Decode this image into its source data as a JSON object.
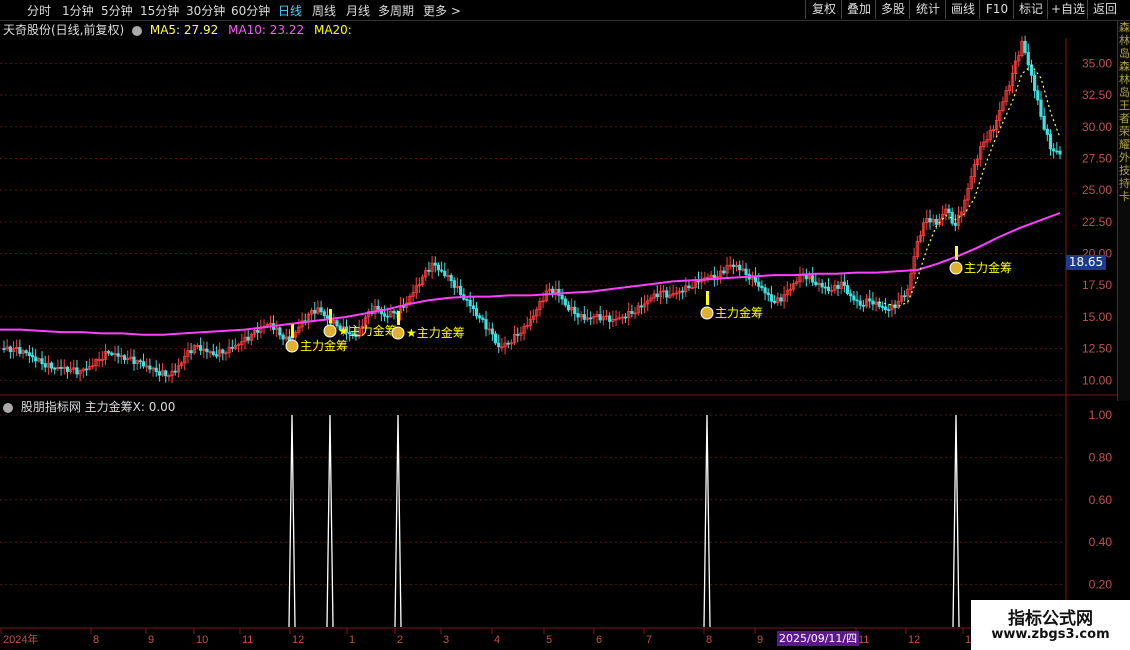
{
  "toolbar": {
    "periods": [
      "分时",
      "1分钟",
      "5分钟",
      "15分钟",
      "30分钟",
      "60分钟",
      "日线",
      "周线",
      "月线",
      "多周期",
      "更多"
    ],
    "more_arrow": ">",
    "buttons": [
      "复权",
      "叠加",
      "多股",
      "统计",
      "画线",
      "F10",
      "标记",
      "+自选",
      "返回"
    ]
  },
  "header": {
    "stock": "天奇股份(日线,前复权)",
    "ma5_label": "MA5: 27.92",
    "ma10_label": "MA10: 23.22",
    "ma20_label": "MA20:",
    "colors": {
      "ma5": "#ffff55",
      "ma10": "#ff55ff",
      "ma20": "#ffff00"
    }
  },
  "indicator_header": "股朋指标网 主力金筹X: 0.00",
  "price_axis": [
    "35.00",
    "32.50",
    "30.00",
    "27.50",
    "25.00",
    "22.50",
    "20.00",
    "17.50",
    "15.00",
    "12.50",
    "10.00"
  ],
  "indicator_axis": [
    "1.00",
    "0.80",
    "0.60",
    "0.40",
    "0.20"
  ],
  "last_price": "18.65",
  "x_axis_labels": [
    "2024年",
    "8",
    "9",
    "10",
    "11",
    "12",
    "1",
    "2",
    "3",
    "4",
    "5",
    "6",
    "7",
    "8",
    "9",
    "11",
    "12",
    "1"
  ],
  "date_badge": "2025/09/11/四",
  "signal_label": "主力金筹",
  "signal_star_label": "★主力金筹",
  "sidebar_chars": [
    "森",
    "林",
    "岛",
    "森",
    "林",
    "岛",
    "王",
    "者",
    "荣",
    "耀",
    "外",
    "技",
    "持",
    "卡"
  ],
  "watermark": {
    "title": "指标公式网",
    "url": "www.zbgs3.com"
  },
  "chart_data": {
    "type": "line",
    "price_range": [
      9,
      37
    ],
    "indicator_range": [
      0,
      1.0
    ],
    "close_prices": [
      12.5,
      12.3,
      12.1,
      11.8,
      11.5,
      11.2,
      11.0,
      10.7,
      10.5,
      11.0,
      11.8,
      12.4,
      12.0,
      11.6,
      11.3,
      11.0,
      10.8,
      10.6,
      10.8,
      11.8,
      12.5,
      12.3,
      12.1,
      12.4,
      12.7,
      13.0,
      13.4,
      14.0,
      14.5,
      13.8,
      13.2,
      14.2,
      15.0,
      15.5,
      14.8,
      14.5,
      14.0,
      13.5,
      14.8,
      15.6,
      15.0,
      15.5,
      16.0,
      17.0,
      18.0,
      19.0,
      18.5,
      18.0,
      17.0,
      16.0,
      14.8,
      13.8,
      12.5,
      13.0,
      13.8,
      14.5,
      15.5,
      16.8,
      17.0,
      16.0,
      15.5,
      15.0,
      15.0,
      14.8,
      14.6,
      15.0,
      15.5,
      16.0,
      16.5,
      16.8,
      16.5,
      17.0,
      17.5,
      18.0,
      18.2,
      18.0,
      18.8,
      19.0,
      18.5,
      18.0,
      17.0,
      16.0,
      16.5,
      17.5,
      18.5,
      18.0,
      17.5,
      17.0,
      17.5,
      16.5,
      16.0,
      16.5,
      16.0,
      15.5,
      16.0,
      17.0,
      21.0,
      23.0,
      22.5,
      23.5,
      22.0,
      24.0,
      27.0,
      29.0,
      30.0,
      32.0,
      34.0,
      36.5,
      34.0,
      31.0,
      28.5,
      27.92
    ],
    "ma20_line": [
      14.0,
      14.0,
      13.9,
      13.8,
      13.8,
      13.7,
      13.7,
      13.6,
      13.6,
      13.7,
      13.8,
      13.9,
      14.0,
      14.2,
      14.4,
      14.6,
      14.8,
      15.0,
      15.3,
      15.6,
      16.0,
      16.3,
      16.5,
      16.6,
      16.6,
      16.7,
      16.7,
      16.8,
      16.9,
      17.0,
      17.2,
      17.4,
      17.6,
      17.8,
      17.9,
      18.0,
      18.1,
      18.2,
      18.3,
      18.3,
      18.4,
      18.4,
      18.5,
      18.5,
      18.6,
      18.7,
      19.2,
      19.8,
      20.5,
      21.3,
      22.0,
      22.6,
      23.2
    ],
    "signal_x_positions": [
      292,
      330,
      398,
      707,
      956
    ],
    "signal_values": [
      1,
      1,
      1,
      1,
      1
    ],
    "series": [
      {
        "name": "MA5",
        "value": 27.92
      },
      {
        "name": "MA10",
        "value": 23.22
      },
      {
        "name": "主力金筹X",
        "value": 0.0
      }
    ]
  }
}
